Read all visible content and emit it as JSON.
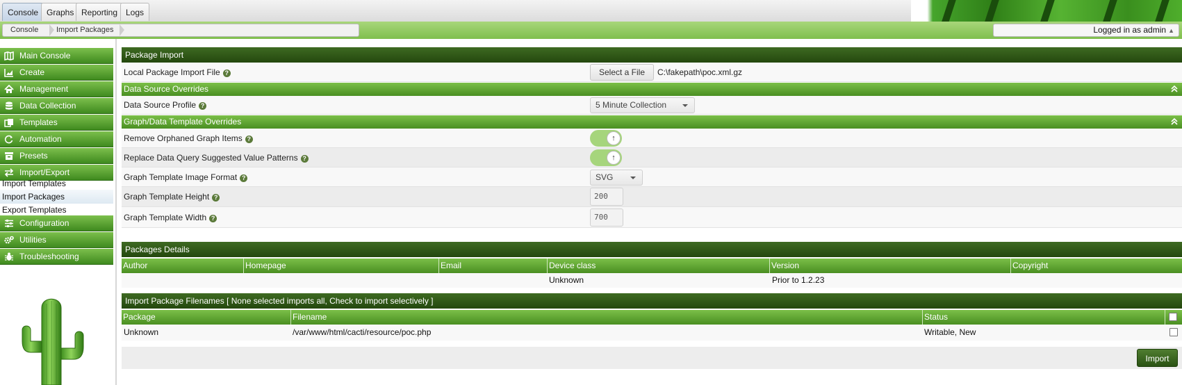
{
  "top_tabs": [
    {
      "label": "Console",
      "active": true
    },
    {
      "label": "Graphs",
      "active": false
    },
    {
      "label": "Reporting",
      "active": false
    },
    {
      "label": "Logs",
      "active": false
    }
  ],
  "breadcrumb": [
    "Console",
    "Import Packages"
  ],
  "user": {
    "label": "Logged in as admin",
    "caret": "▲"
  },
  "sidebar": {
    "items": [
      {
        "label": "Main Console",
        "icon": "map-icon"
      },
      {
        "label": "Create",
        "icon": "chart-area-icon"
      },
      {
        "label": "Management",
        "icon": "home-icon"
      },
      {
        "label": "Data Collection",
        "icon": "database-icon"
      },
      {
        "label": "Templates",
        "icon": "copy-icon"
      },
      {
        "label": "Automation",
        "icon": "refresh-icon"
      },
      {
        "label": "Presets",
        "icon": "archive-icon"
      },
      {
        "label": "Import/Export",
        "icon": "exchange-icon"
      }
    ],
    "subitems": [
      {
        "label": "Import Templates",
        "selected": false
      },
      {
        "label": "Import Packages",
        "selected": true
      },
      {
        "label": "Export Templates",
        "selected": false
      }
    ],
    "items_after": [
      {
        "label": "Configuration",
        "icon": "sliders-icon"
      },
      {
        "label": "Utilities",
        "icon": "cogs-icon"
      },
      {
        "label": "Troubleshooting",
        "icon": "bug-icon"
      }
    ]
  },
  "package_import": {
    "title": "Package Import",
    "file_label": "Local Package Import File",
    "select_button": "Select a File",
    "file_value": "C:\\fakepath\\poc.xml.gz"
  },
  "ds_overrides": {
    "title": "Data Source Overrides",
    "profile_label": "Data Source Profile",
    "profile_value": "5 Minute Collection"
  },
  "graph_overrides": {
    "title": "Graph/Data Template Overrides",
    "remove_orphaned_label": "Remove Orphaned Graph Items",
    "remove_orphaned_on": true,
    "replace_patterns_label": "Replace Data Query Suggested Value Patterns",
    "replace_patterns_on": true,
    "image_format_label": "Graph Template Image Format",
    "image_format_value": "SVG",
    "height_label": "Graph Template Height",
    "height_value": "200",
    "width_label": "Graph Template Width",
    "width_value": "700"
  },
  "packages_details": {
    "title": "Packages Details",
    "columns": [
      "Author",
      "Homepage",
      "Email",
      "Device class",
      "Version",
      "Copyright"
    ],
    "row": [
      "",
      "",
      "",
      "Unknown",
      "Prior to 1.2.23",
      ""
    ]
  },
  "filenames": {
    "title": "Import Package Filenames [ None selected imports all, Check to import selectively ]",
    "columns": [
      "Package",
      "Filename",
      "Status"
    ],
    "row": [
      "Unknown",
      "/var/www/html/cacti/resource/poc.php",
      "Writable, New"
    ]
  },
  "import_button": "Import",
  "colors": {
    "dark_green": "#2f5a17",
    "light_green": "#6cb33e",
    "toggle_on": "#a6d57c"
  }
}
